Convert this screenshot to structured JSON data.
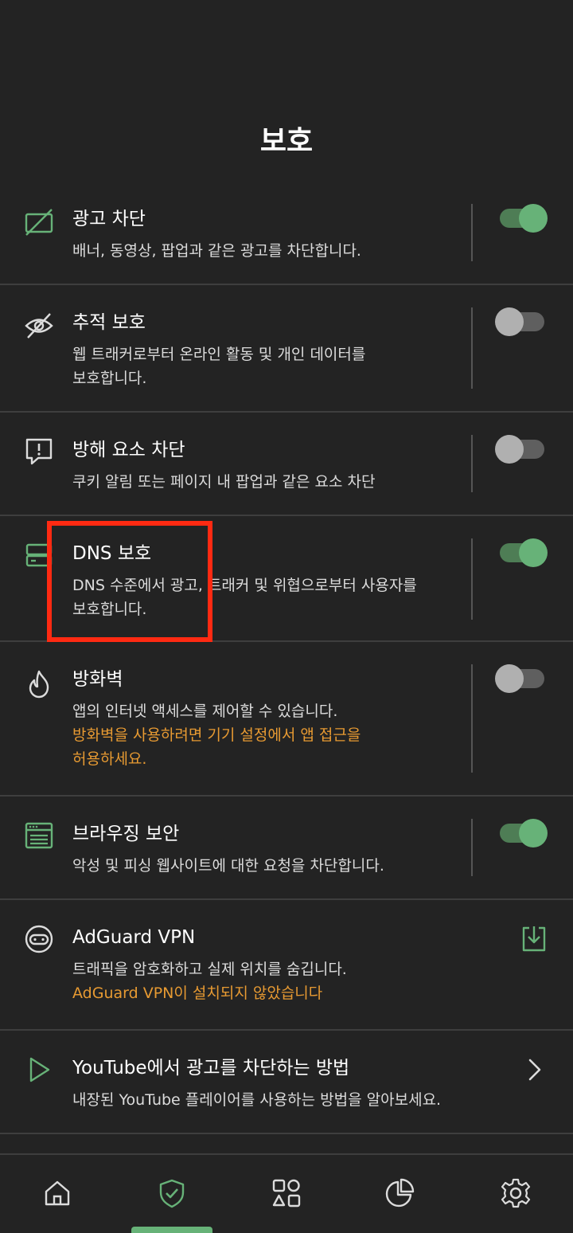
{
  "page": {
    "title": "보호"
  },
  "colors": {
    "accent": "#67b278",
    "warning": "#e79a32",
    "highlight": "#ff2a12"
  },
  "items": [
    {
      "name": "광고 차단",
      "desc": [
        "배너, 동영상, 팝업과 같은 광고를 차단합니다."
      ],
      "icon": "ad-blocked-icon",
      "enabled": true
    },
    {
      "name": "추적 보호",
      "desc": [
        "웹 트래커로부터 온라인 활동 및 개인 데이터를",
        "보호합니다."
      ],
      "icon": "eye-crossed-icon",
      "enabled": false
    },
    {
      "name": "방해 요소 차단",
      "desc": [
        "쿠키 알림 또는 페이지 내 팝업과 같은 요소 차단"
      ],
      "icon": "alert-message-icon",
      "enabled": false
    },
    {
      "name": "DNS 보호",
      "desc": [
        "DNS 수준에서 광고, 트래커 및 위협으로부터 사용자를",
        "보호합니다."
      ],
      "icon": "server-icon",
      "enabled": true
    },
    {
      "name": "방화벽",
      "desc": [
        "앱의 인터넷 액세스를 제어할 수 있습니다."
      ],
      "warn": [
        "방화벽을 사용하려면 기기 설정에서 앱 접근을",
        "허용하세요."
      ],
      "icon": "fire-icon",
      "enabled": false
    },
    {
      "name": "브라우징 보안",
      "desc": [
        "악성 및 피싱 웹사이트에 대한 요청을 차단합니다."
      ],
      "icon": "browser-icon",
      "enabled": true
    },
    {
      "name": "AdGuard VPN",
      "desc": [
        "트래픽을 암호화하고 실제 위치를 숨깁니다."
      ],
      "warn": [
        "AdGuard VPN이 설치되지 않았습니다"
      ],
      "icon": "vpn-robot-icon",
      "action": "download-icon"
    },
    {
      "name": "YouTube에서 광고를 차단하는 방법",
      "desc": [
        "내장된 YouTube 플레이어를 사용하는 방법을 알아보세요."
      ],
      "icon": "play-icon",
      "action": "chevron-right-icon"
    }
  ],
  "nav": [
    {
      "icon": "home-icon",
      "active": false
    },
    {
      "icon": "shield-check-icon",
      "active": true
    },
    {
      "icon": "apps-icon",
      "active": false
    },
    {
      "icon": "pie-chart-icon",
      "active": false
    },
    {
      "icon": "gear-icon",
      "active": false
    }
  ]
}
